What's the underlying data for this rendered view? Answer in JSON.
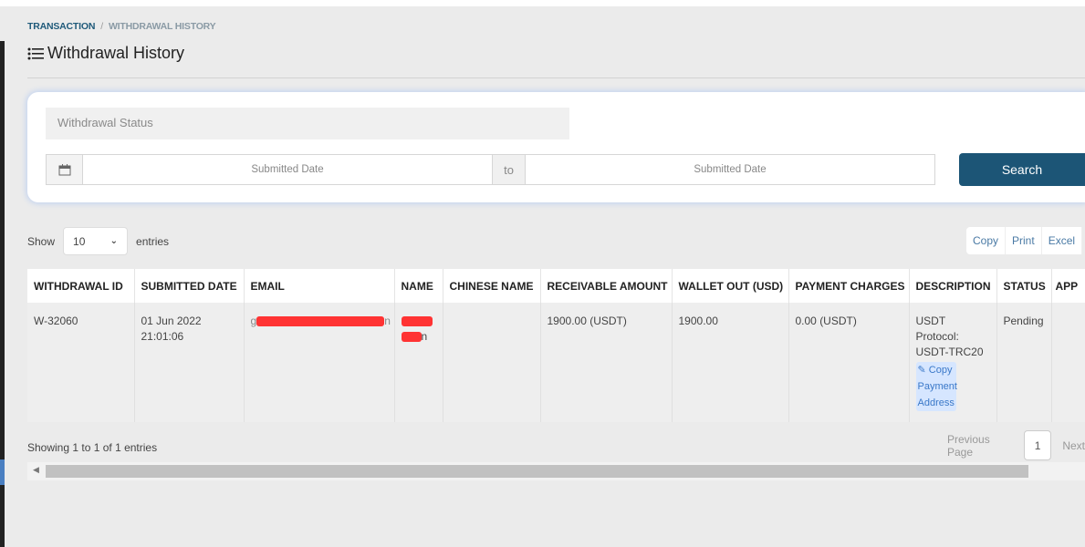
{
  "breadcrumb": {
    "parent": "TRANSACTION",
    "separator": "/",
    "current": "WITHDRAWAL HISTORY"
  },
  "page_title": "Withdrawal History",
  "filters": {
    "status_placeholder": "Withdrawal Status",
    "date_from_placeholder": "Submitted Date",
    "to_label": "to",
    "date_to_placeholder": "Submitted Date",
    "search_label": "Search"
  },
  "length": {
    "show_label": "Show",
    "value": "10",
    "entries_label": "entries"
  },
  "export_buttons": [
    "Copy",
    "Print",
    "Excel"
  ],
  "table": {
    "headers": [
      "WITHDRAWAL ID",
      "SUBMITTED DATE",
      "EMAIL",
      "NAME",
      "CHINESE NAME",
      "RECEIVABLE AMOUNT",
      "WALLET OUT (USD)",
      "PAYMENT CHARGES",
      "DESCRIPTION",
      "STATUS",
      "APP"
    ],
    "rows": [
      {
        "id": "W-32060",
        "date": "01 Jun 2022",
        "time": "21:01:06",
        "email_start": "g",
        "email_end": "n",
        "name_end": "n",
        "chinese_name": "",
        "receivable": "1900.00 (USDT)",
        "wallet_out": "1900.00",
        "charges": "0.00 (USDT)",
        "description": [
          "USDT",
          "Protocol:",
          "USDT-TRC20"
        ],
        "copy_link": "Copy Payment Address",
        "status": "Pending",
        "app": ""
      }
    ]
  },
  "footer": {
    "info": "Showing 1 to 1 of 1 entries",
    "previous": "Previous Page",
    "page": "1",
    "next": "Next"
  },
  "colors": {
    "primary": "#1c5576",
    "redaction": "#ff3333"
  }
}
